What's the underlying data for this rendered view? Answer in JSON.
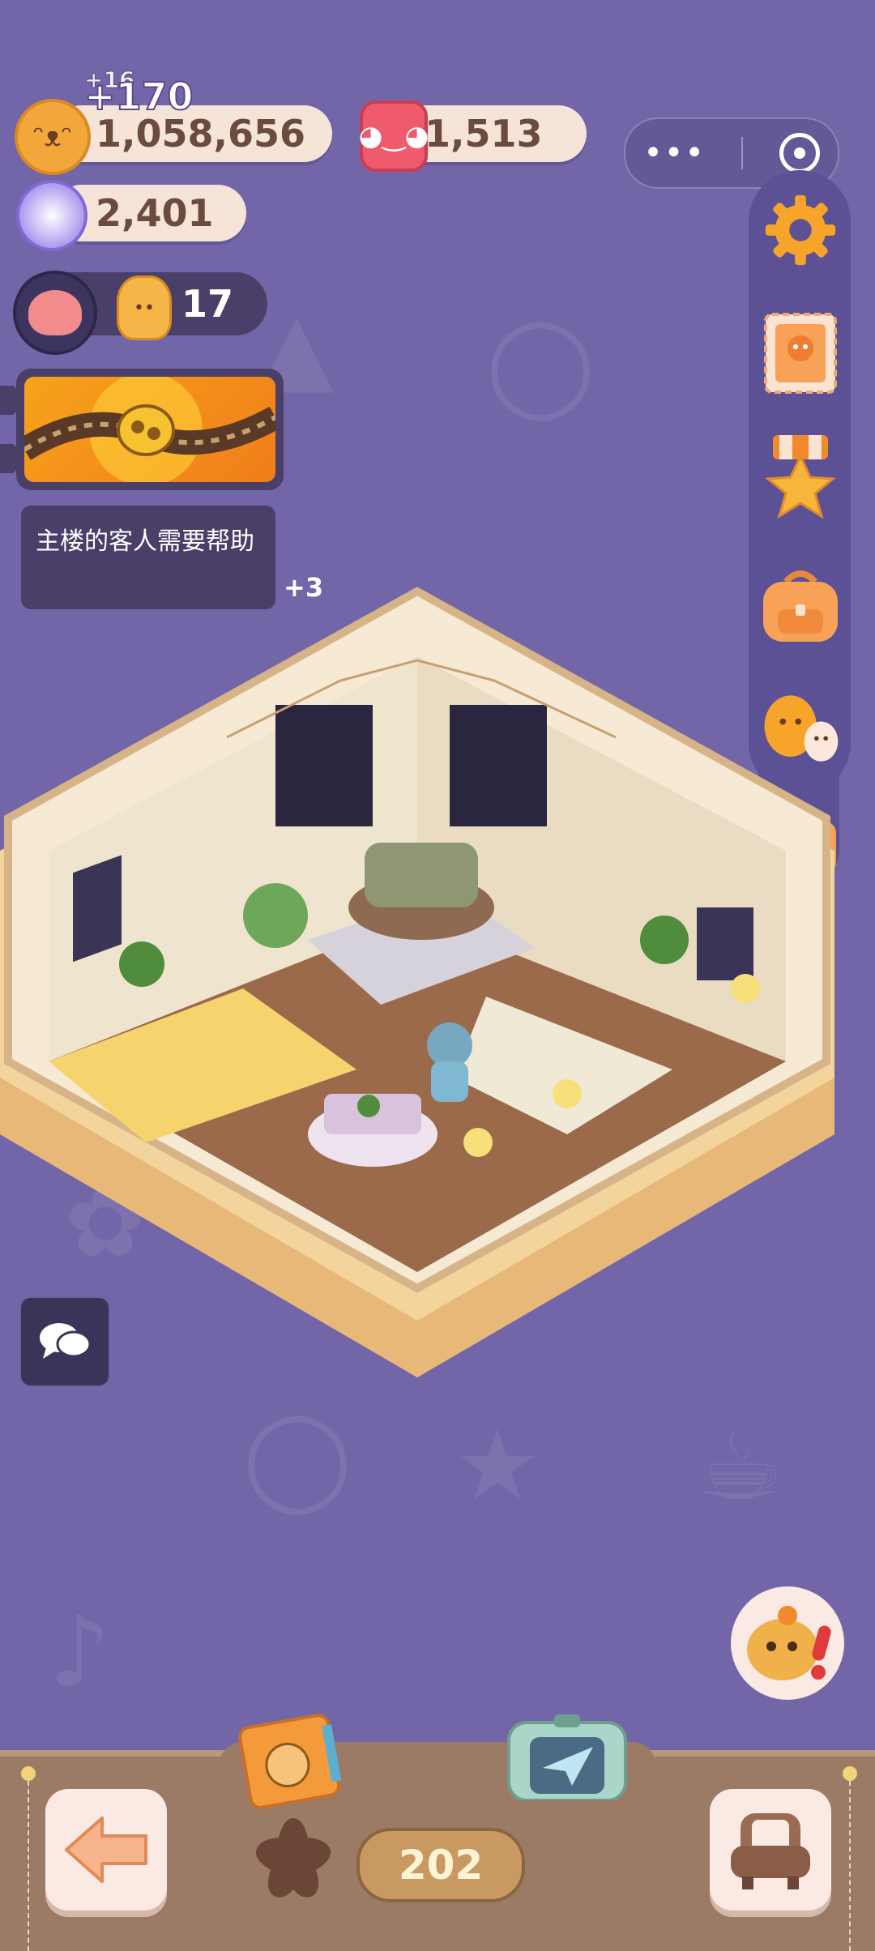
{
  "resources": {
    "coins": "1,058,656",
    "coin_gain_small": "+16",
    "coin_gain": "+170",
    "hearts": "1,513",
    "candy": "2,401",
    "cookie_people": "17"
  },
  "quest": {
    "task_text": "主楼的客人需要帮助",
    "extra": "+3"
  },
  "level": "202",
  "colors": {
    "background": "#7266a8",
    "pill": "#f6e4d9",
    "accent_orange": "#f7a21b",
    "bottom_bar": "#9b7a66"
  },
  "icons": {
    "settings": "gear-icon",
    "stamp": "stamp-icon",
    "medal": "medal-icon",
    "backpack": "backpack-icon",
    "friends": "friends-icon",
    "camera": "camera-icon",
    "chat": "chat-icon",
    "back": "back-arrow-icon",
    "furniture": "armchair-icon"
  }
}
